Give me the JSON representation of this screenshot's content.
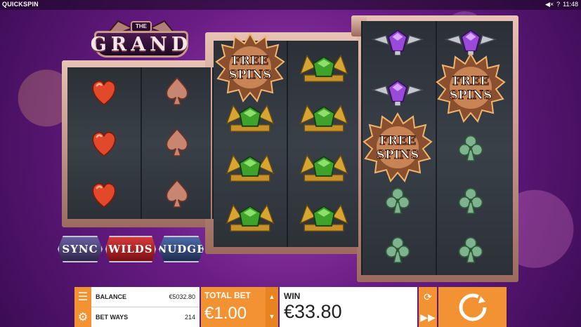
{
  "topbar": {
    "brand": "QUICKSPIN",
    "sound_icon": "speaker-icon",
    "help": "?",
    "time": "11:48"
  },
  "logo": {
    "small": "THE",
    "title": "GRAND"
  },
  "reels": [
    [
      "heart",
      "heart",
      "heart"
    ],
    [
      "spade",
      "spade",
      "spade"
    ],
    [
      "free-spins",
      "gem-green",
      "gem-green",
      "gem-green"
    ],
    [
      "gem-green",
      "gem-green",
      "gem-green",
      "gem-green"
    ],
    [
      "gem-purple",
      "gem-purple",
      "free-spins",
      "club",
      "club"
    ],
    [
      "gem-purple",
      "free-spins",
      "club",
      "club",
      "club"
    ]
  ],
  "free_spins_label": {
    "line1": "FREE",
    "line2": "SPINS"
  },
  "features": {
    "sync": "SYNC",
    "wilds": "WILDS",
    "nudge": "NUDGE"
  },
  "panel": {
    "balance_label": "BALANCE",
    "balance_value": "€5032.80",
    "betways_label": "BET WAYS",
    "betways_value": "214",
    "totalbet_label": "TOTAL BET",
    "totalbet_value": "€1.00",
    "win_label": "WIN",
    "win_value": "€33.80"
  },
  "colors": {
    "accent": "#f39232",
    "panel_white": "#ffffff",
    "heart": "#e2482a",
    "gem_green": "#3fa22a",
    "gem_purple": "#9a4ad8",
    "club": "#7fb28e"
  }
}
